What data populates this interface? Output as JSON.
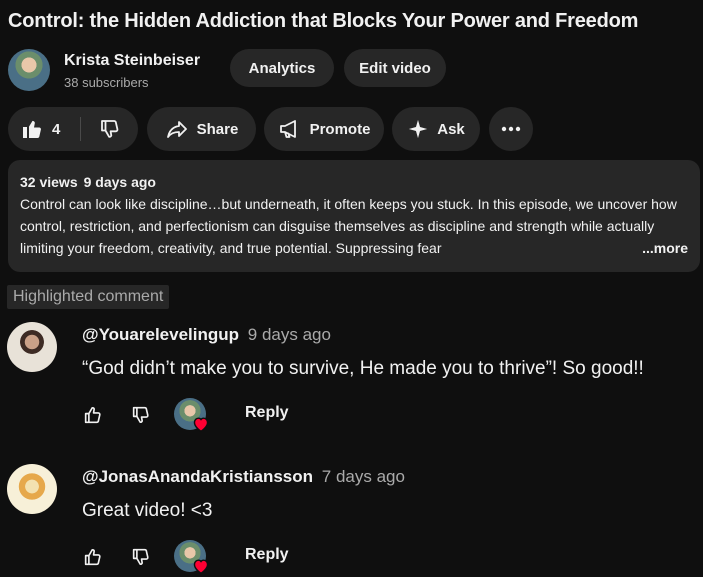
{
  "video": {
    "title": "Control: the Hidden Addiction that Blocks Your Power and Freedom"
  },
  "channel": {
    "name": "Krista Steinbeiser",
    "subscribers": "38 subscribers",
    "analytics_label": "Analytics",
    "edit_label": "Edit video"
  },
  "actions": {
    "like_count": "4",
    "share_label": "Share",
    "promote_label": "Promote",
    "ask_label": "Ask"
  },
  "description": {
    "views": "32 views",
    "date": "9 days ago",
    "text": "Control can look like discipline…but underneath, it often keeps you stuck. In this episode, we uncover how control, restriction, and perfectionism can disguise themselves as discipline and strength while actually limiting your freedom, creativity, and true potential. Suppressing fear",
    "more_label": "...more"
  },
  "highlighted_label": "Highlighted comment",
  "comments": [
    {
      "author": "@Youarelevelingup",
      "time": "9 days ago",
      "text": "“God didn’t make you to survive, He made you to thrive”! So good!!",
      "reply_label": "Reply"
    },
    {
      "author": "@JonasAnandaKristiansson",
      "time": "7 days ago",
      "text": "Great video! <3",
      "reply_label": "Reply"
    }
  ],
  "icons": {
    "like": "thumbs-up-icon",
    "dislike": "thumbs-down-icon",
    "share": "share-arrow-icon",
    "promote": "megaphone-icon",
    "ask": "sparkle-icon",
    "more": "more-horizontal-icon",
    "heart": "creator-heart-icon"
  },
  "colors": {
    "background": "#0f0f0f",
    "surface": "#272727",
    "text_primary": "#f1f1f1",
    "text_secondary": "#aaaaaa",
    "heart": "#ff0033"
  }
}
